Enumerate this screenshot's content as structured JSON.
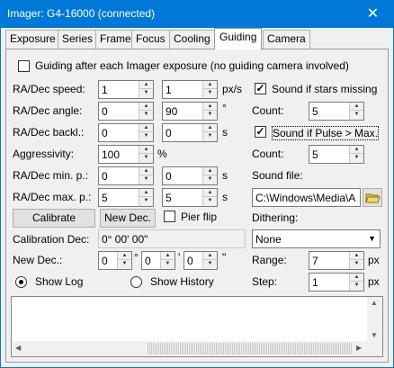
{
  "window": {
    "title": "Imager: G4-16000 (connected)",
    "close_glyph": "✕"
  },
  "tabs": [
    "Exposure",
    "Series",
    "Frame",
    "Focus",
    "Cooling",
    "Guiding",
    "Camera"
  ],
  "active_tab": "Guiding",
  "guiding_after_exposure": {
    "label": "Guiding after each Imager exposure (no guiding camera involved)",
    "checked": false
  },
  "left": {
    "radec_speed": {
      "label": "RA/Dec speed:",
      "ra": "1",
      "dec": "1",
      "unit": "px/s"
    },
    "radec_angle": {
      "label": "RA/Dec angle:",
      "ra": "0",
      "dec": "90",
      "unit": "°"
    },
    "radec_backlash": {
      "label": "RA/Dec backl.:",
      "ra": "0",
      "dec": "0",
      "unit": "s"
    },
    "aggressivity": {
      "label": "Aggressivity:",
      "value": "100",
      "unit": "%"
    },
    "radec_min_pulse": {
      "label": "RA/Dec min. p.:",
      "ra": "0",
      "dec": "0",
      "unit": "s"
    },
    "radec_max_pulse": {
      "label": "RA/Dec max. p.:",
      "ra": "5",
      "dec": "5",
      "unit": "s"
    },
    "calibrate_button": "Calibrate",
    "new_dec_button": "New Dec.",
    "pier_flip": {
      "label": "Pier flip",
      "checked": false
    },
    "calibration_dec": {
      "label": "Calibration Dec:",
      "value": "0° 00' 00\""
    },
    "new_dec": {
      "label": "New Dec.:",
      "deg": "0",
      "min": "0",
      "sec": "0",
      "deg_unit": "°",
      "min_unit": "'",
      "sec_unit": "\""
    }
  },
  "right": {
    "sound_stars_missing": {
      "label": "Sound if stars missing",
      "checked": true
    },
    "count1": {
      "label": "Count:",
      "value": "5"
    },
    "sound_pulse_max": {
      "label": "Sound if Pulse > Max.",
      "checked": true
    },
    "count2": {
      "label": "Count:",
      "value": "5"
    },
    "sound_file": {
      "label": "Sound file:",
      "value": "C:\\Windows\\Media\\A"
    },
    "dithering": {
      "label": "Dithering:",
      "value": "None"
    },
    "range": {
      "label": "Range:",
      "value": "7",
      "unit": "px"
    },
    "step": {
      "label": "Step:",
      "value": "1",
      "unit": "px"
    }
  },
  "log_view": {
    "show_log_label": "Show Log",
    "show_history_label": "Show History",
    "selected": "Show Log"
  },
  "log_text": ""
}
